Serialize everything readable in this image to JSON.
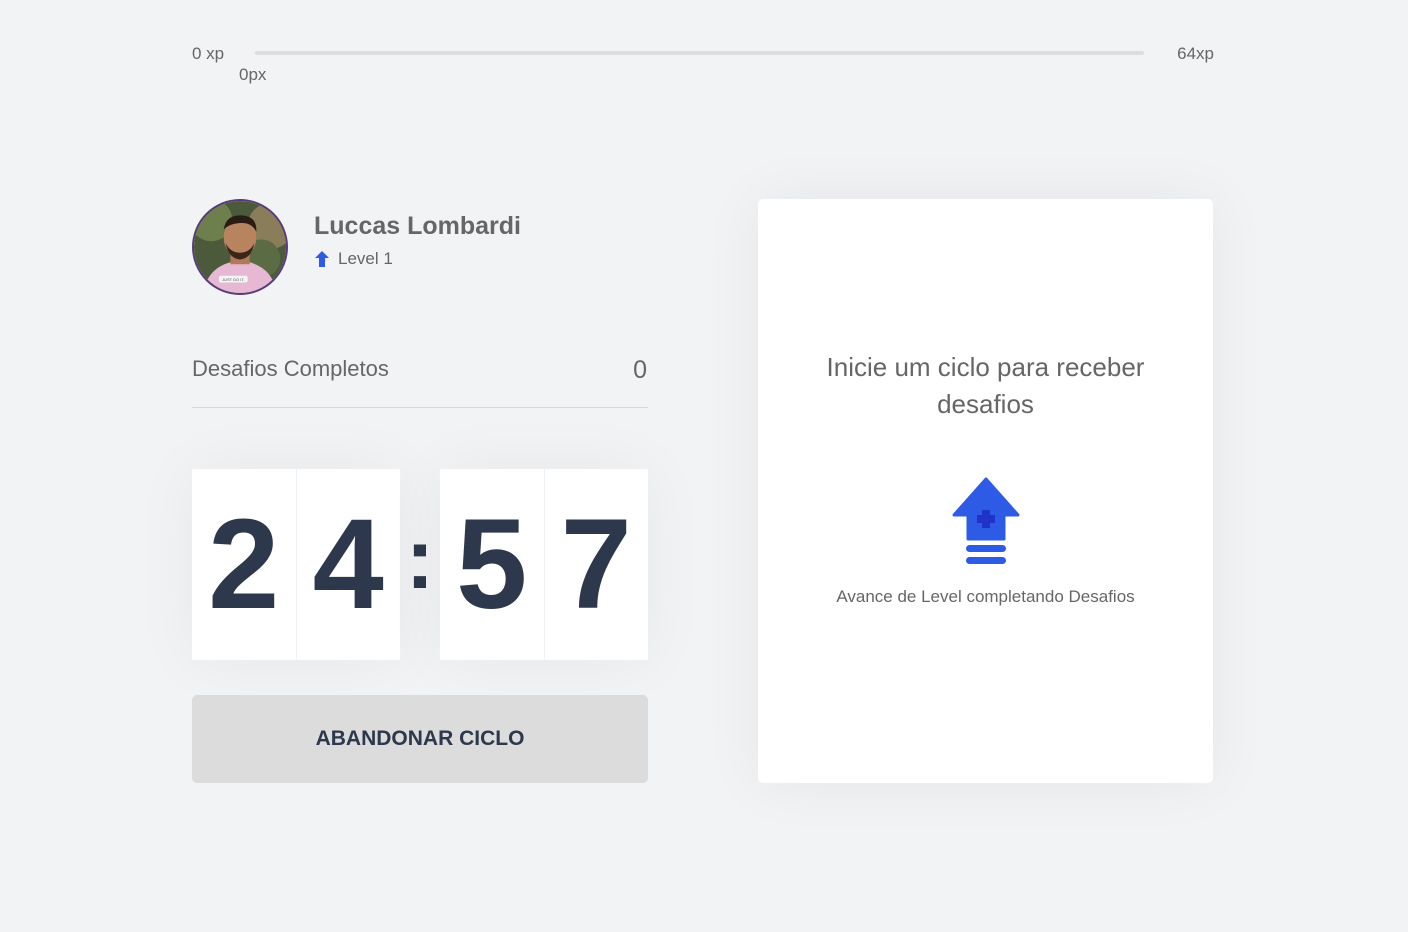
{
  "experience": {
    "min_label": "0 xp",
    "max_label": "64xp",
    "current_label": "0px",
    "progress_fraction": 0
  },
  "profile": {
    "name": "Luccas Lombardi",
    "level_label": "Level 1",
    "level_icon": "level-up-arrow-icon",
    "avatar_shirt_text": "JUST DO IT."
  },
  "completed_challenges": {
    "label": "Desafios Completos",
    "count": "0"
  },
  "countdown": {
    "minute_left": "2",
    "minute_right": "4",
    "separator": ":",
    "second_left": "5",
    "second_right": "7"
  },
  "actions": {
    "abandon_label": "ABANDONAR CICLO"
  },
  "challenge_box": {
    "title": "Inicie um ciclo para receber desafios",
    "icon": "level-up-icon",
    "hint": "Avance de Level completando Desafios"
  },
  "colors": {
    "background": "#f2f3f5",
    "text": "#666666",
    "title": "#2e384d",
    "accent_blue": "#2e5be6",
    "button_gray": "#dcdcdc"
  }
}
